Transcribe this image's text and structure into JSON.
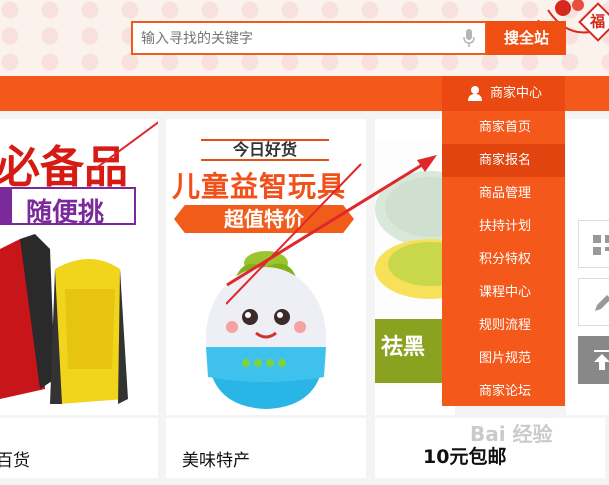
{
  "search": {
    "placeholder": "输入寻找的关键字",
    "button_label": "搜全站"
  },
  "header": {
    "fu_char": "福"
  },
  "cards": [
    {
      "headline": "必备品",
      "sub_banner": "随便挑",
      "caption": "百货"
    },
    {
      "today_label": "今日好货",
      "title": "儿童益智玩具",
      "value_banner": "超值特价",
      "caption": "美味特产"
    },
    {
      "banner_text": "祛黑",
      "caption": "10元包邮"
    }
  ],
  "dropdown": {
    "header_label": "商家中心",
    "items": [
      "商家首页",
      "商家报名",
      "商品管理",
      "扶持计划",
      "积分特权",
      "课程中心",
      "规则流程",
      "图片规范",
      "商家论坛"
    ],
    "active_index": 1
  },
  "watermark": "Bai 经验",
  "colors": {
    "brand_orange": "#f4581a",
    "accent_red": "#d61a14",
    "purple": "#7a2a9a"
  }
}
